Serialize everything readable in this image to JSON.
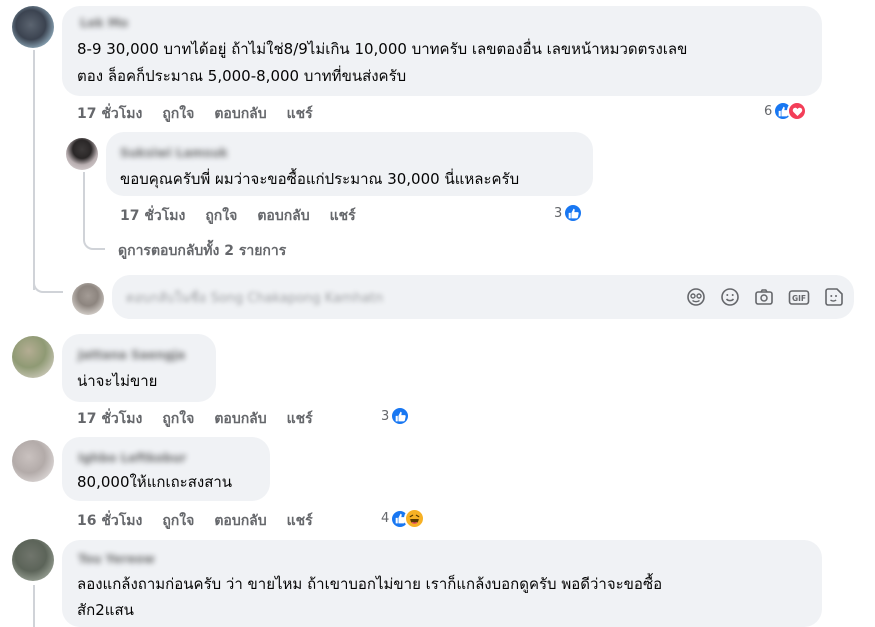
{
  "comments": [
    {
      "author": "Lek Mo",
      "text_line1": "8-9 30,000 บาทได้อยู่ ถ้าไม่ใช่8/9ไม่เกิน 10,000 บาทครับ เลขตองอื่น เลขหน้าหมวดตรงเลข",
      "text_line2": "ตอง ล็อคก็ประมาณ 5,000-8,000 บาทที่ขนส่งครับ",
      "time": "17 ชั่วโมง",
      "like": "ถูกใจ",
      "reply": "ตอบกลับ",
      "share": "แชร์",
      "reaction_count": "6"
    },
    {
      "author": "Suksiwi Lamsuk",
      "text_line1": "ขอบคุณครับพี่ ผมว่าจะขอซื้อแก่ประมาณ 30,000 นี่แหละครับ",
      "time": "17 ชั่วโมง",
      "like": "ถูกใจ",
      "reply": "ตอบกลับ",
      "share": "แชร์",
      "reaction_count": "3"
    },
    {
      "author": "Jattana Saengja",
      "text_line1": "น่าจะไม่ขาย",
      "time": "17 ชั่วโมง",
      "like": "ถูกใจ",
      "reply": "ตอบกลับ",
      "share": "แชร์",
      "reaction_count": "3"
    },
    {
      "author": "Ighbo Leftkobur",
      "text_line1": "80,000ให้แกเถะสงสาน",
      "time": "16 ชั่วโมง",
      "like": "ถูกใจ",
      "reply": "ตอบกลับ",
      "share": "แชร์",
      "reaction_count": "4"
    },
    {
      "author": "Tou Yereow",
      "text_line1": "ลองแกล้งถามก่อนครับ ว่า ขายไหม ถ้าเขาบอกไม่ขาย เราก็แกล้งบอกดูครับ พอดีว่าจะขอซื้อ",
      "text_line2": "สัก2แสน"
    }
  ],
  "view_replies": "ดูการตอบกลับทั้ง 2 รายการ",
  "composer": {
    "placeholder": "ตอบกลับในชื่อ Song Chakapong Kamhatn"
  },
  "composer_icons": [
    "sticker-face-icon",
    "emoji-icon",
    "camera-icon",
    "gif-icon",
    "sticker-icon"
  ],
  "colors": {
    "bubble": "#f0f2f5",
    "like_blue": "#1877f2",
    "love_red": "#f33e58",
    "haha_yellow": "#f7b125",
    "meta_gray": "#65676b"
  }
}
